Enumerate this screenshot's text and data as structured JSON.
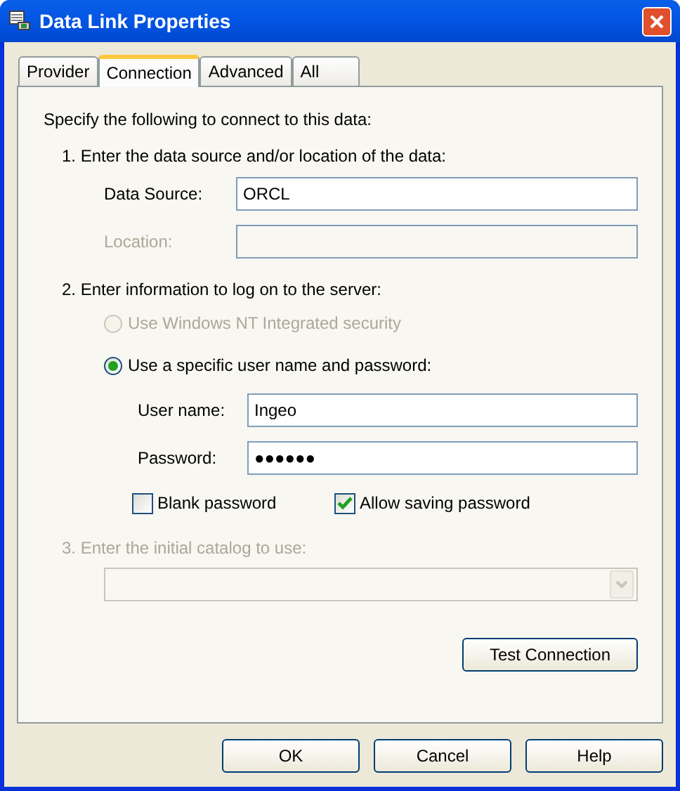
{
  "window": {
    "title": "Data Link Properties"
  },
  "tabs": [
    {
      "label": "Provider",
      "selected": false
    },
    {
      "label": "Connection",
      "selected": true
    },
    {
      "label": "Advanced",
      "selected": false
    },
    {
      "label": "All",
      "selected": false
    }
  ],
  "intro": "Specify the following to connect to this data:",
  "step_1": {
    "heading": "1. Enter the data source and/or location of the data:",
    "fields": [
      {
        "label": "Data Source:",
        "value": "ORCL",
        "disabled": false
      },
      {
        "label": "Location:",
        "disabled": true
      }
    ]
  },
  "step_2": {
    "heading": "2. Enter information to log on to the server:",
    "options": [
      {
        "label": "Use Windows NT Integrated security",
        "selected": false,
        "disabled": true
      },
      {
        "label": "Use a specific user name and password:",
        "selected": true,
        "disabled": false
      }
    ],
    "fields": [
      {
        "label": "User name:",
        "value": "Ingeo"
      },
      {
        "label": "Password:",
        "value": "●●●●●●"
      }
    ],
    "checkboxes": [
      {
        "label": "Blank password",
        "checked": false
      },
      {
        "label": "Allow saving password",
        "checked": true
      }
    ]
  },
  "step_3": {
    "heading": "3. Enter the initial catalog to use:",
    "disabled": true
  },
  "test_button": "Test Connection",
  "buttons": [
    "OK",
    "Cancel",
    "Help"
  ]
}
